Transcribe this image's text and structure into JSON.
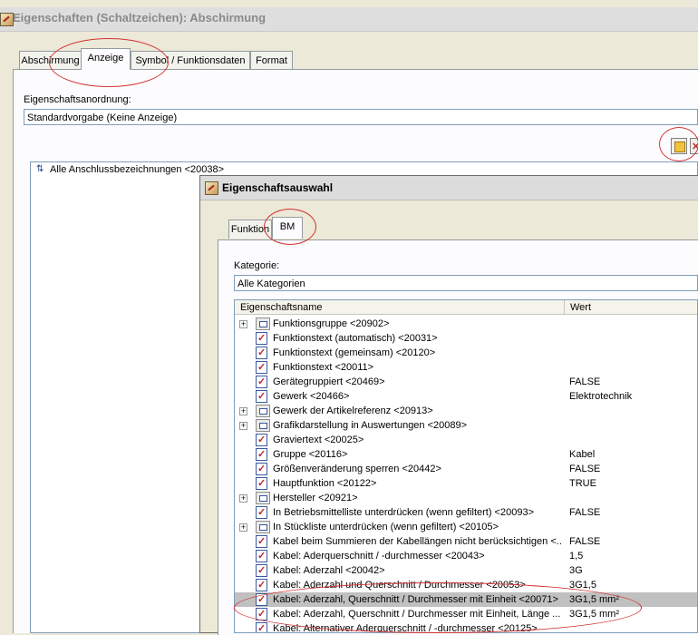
{
  "outer": {
    "title": "Eigenschaften (Schaltzeichen): Abschirmung",
    "tabs": [
      "Abschirmung",
      "Anzeige",
      "Symbol / Funktionsdaten",
      "Format"
    ],
    "active_tab": 1,
    "arrangement_label": "Eigenschaftsanordnung:",
    "arrangement_value": "Standardvorgabe (Keine Anzeige)",
    "tree_item": "Alle Anschlussbezeichnungen <20038>"
  },
  "dialog": {
    "title": "Eigenschaftsauswahl",
    "tabs": [
      "Funktion",
      "BM"
    ],
    "active_tab": 1,
    "category_label": "Kategorie:",
    "category_value": "Alle Kategorien",
    "columns": [
      "Eigenschaftsname",
      "Wert"
    ],
    "rows": [
      {
        "name": "Funktionsgruppe <20902>",
        "value": "",
        "type": "group"
      },
      {
        "name": "Funktionstext (automatisch) <20031>",
        "value": "",
        "type": "prop"
      },
      {
        "name": "Funktionstext (gemeinsam) <20120>",
        "value": "",
        "type": "prop"
      },
      {
        "name": "Funktionstext <20011>",
        "value": "",
        "type": "prop"
      },
      {
        "name": "Gerätegruppiert <20469>",
        "value": "FALSE",
        "type": "prop"
      },
      {
        "name": "Gewerk <20466>",
        "value": "Elektrotechnik",
        "type": "prop"
      },
      {
        "name": "Gewerk der Artikelreferenz <20913>",
        "value": "",
        "type": "group"
      },
      {
        "name": "Grafikdarstellung in Auswertungen <20089>",
        "value": "",
        "type": "group"
      },
      {
        "name": "Graviertext <20025>",
        "value": "",
        "type": "prop"
      },
      {
        "name": "Gruppe <20116>",
        "value": "Kabel",
        "type": "prop"
      },
      {
        "name": "Größenveränderung sperren <20442>",
        "value": "FALSE",
        "type": "prop"
      },
      {
        "name": "Hauptfunktion <20122>",
        "value": "TRUE",
        "type": "prop"
      },
      {
        "name": "Hersteller <20921>",
        "value": "",
        "type": "group"
      },
      {
        "name": "In Betriebsmittelliste unterdrücken (wenn gefiltert) <20093>",
        "value": "FALSE",
        "type": "prop"
      },
      {
        "name": "In Stückliste unterdrücken (wenn gefiltert) <20105>",
        "value": "",
        "type": "group"
      },
      {
        "name": "Kabel beim Summieren der Kabellängen nicht berücksichtigen <...",
        "value": "FALSE",
        "type": "prop"
      },
      {
        "name": "Kabel: Aderquerschnitt / -durchmesser <20043>",
        "value": "1,5",
        "type": "prop"
      },
      {
        "name": "Kabel: Aderzahl <20042>",
        "value": "3G",
        "type": "prop"
      },
      {
        "name": "Kabel: Aderzahl und Querschnitt / Durchmesser <20053>",
        "value": "3G1,5",
        "type": "prop"
      },
      {
        "name": "Kabel: Aderzahl, Querschnitt / Durchmesser mit Einheit <20071>",
        "value": "3G1,5 mm²",
        "type": "prop",
        "selected": true
      },
      {
        "name": "Kabel: Aderzahl, Querschnitt / Durchmesser mit Einheit, Länge ...",
        "value": "3G1,5 mm²",
        "type": "prop"
      },
      {
        "name": "Kabel: Alternativer Aderquerschnitt / -durchmesser <20125>",
        "value": "",
        "type": "prop"
      }
    ]
  },
  "colors": {
    "annotation_ring": "#d23232",
    "selection": "#c0c0c0",
    "panel": "#ece9d8"
  }
}
